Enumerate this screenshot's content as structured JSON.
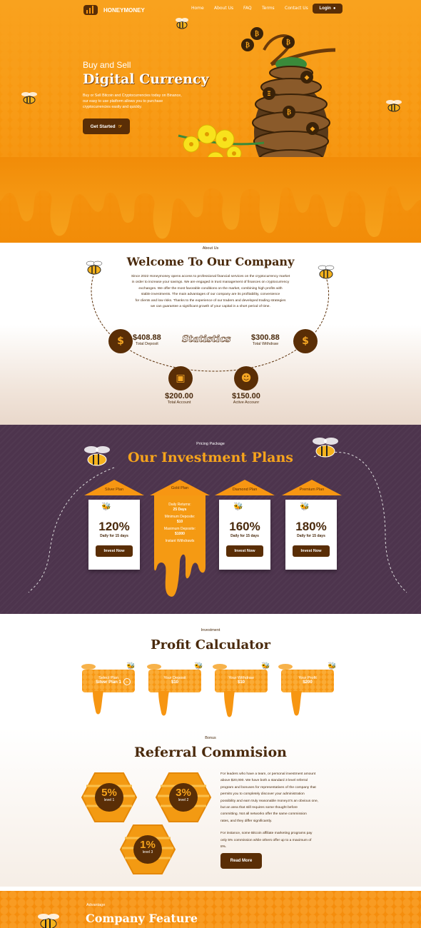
{
  "nav": {
    "brand": "HONEYMONEY",
    "links": [
      "Home",
      "About Us",
      "FAQ",
      "Terms",
      "Contact Us"
    ],
    "login": "Login"
  },
  "hero": {
    "kicker": "Buy and Sell",
    "title": "Digital Currency",
    "text": [
      "Buy or Sell Bitcoin and Cryptocurrencies today on Binance,",
      "our easy to use platform allows you to purchase",
      "cryptocurrencies easily and quickly."
    ],
    "cta": "Get Started",
    "hive_label": "PM"
  },
  "about": {
    "kicker": "About Us",
    "title": "Welcome To Our Company",
    "text": [
      "Since 2022 Honeymoney opens access to professional financial services on the cryptocurrency market",
      "in order to increase your savings. We are engaged in trust management of finances on cryptocurrency",
      "exchanges. We offer the most favorable conditions on the market, combining high profits with",
      "stable investments. The main advantages of our company are its profitability, convenience",
      "for clients and low risks. Thanks to the experience of our traders and developed trading strategies",
      "we can guarantee a significant growth of your capital in a short period of time."
    ],
    "stats_title": "Statistics",
    "stats": [
      {
        "value": "$408.88",
        "label": "Total Deposit"
      },
      {
        "value": "$300.88",
        "label": "Total Withdraw"
      },
      {
        "value": "$200.00",
        "label": "Total Account"
      },
      {
        "value": "$150.00",
        "label": "Active Accounr"
      }
    ]
  },
  "plans": {
    "kicker": "Pricing Package",
    "title": "Our Investment Plans",
    "items": [
      {
        "name": "Silver Plan",
        "pct": "120%",
        "days": "Daily for 15 days",
        "btn": "Invest Now"
      },
      {
        "name": "Diamond Plan",
        "pct": "160%",
        "days": "Daily for 15 days",
        "btn": "Invest Now"
      },
      {
        "name": "Premium Plan",
        "pct": "180%",
        "days": "Daily for 15 days",
        "btn": "Invest Now"
      }
    ],
    "gold": {
      "name": "Gold Plan",
      "lines": [
        [
          "Daily Returns:",
          "25 Days"
        ],
        [
          "Minimum Deposite:",
          "$10"
        ],
        [
          "Maximum Deposite:",
          "$1000"
        ],
        [
          "Instant Withdrawls",
          ""
        ]
      ]
    }
  },
  "calc": {
    "kicker": "Investment",
    "title": "Profit Calculator",
    "boxes": [
      {
        "label": "Select Plan",
        "value": "Silver Plan 1"
      },
      {
        "label": "Your Deposit",
        "value": "$10"
      },
      {
        "label": "Your Withdraw",
        "value": "$10"
      },
      {
        "label": "Your Profit",
        "value": "$200"
      }
    ]
  },
  "referral": {
    "kicker": "Bonus",
    "title": "Referral Commision",
    "levels": [
      {
        "pct": "5%",
        "level": "level 1"
      },
      {
        "pct": "3%",
        "level": "level 2"
      },
      {
        "pct": "1%",
        "level": "level 3"
      }
    ],
    "p1": [
      "For leaders who have a team, or personal investment amount",
      "above $20,000.   We have both a standard 3 level referral",
      "program and bonuses for representatives of the company that",
      "permits you to completely discover your administration",
      "possibility and earn truly reasonable money.It's an obvious one,",
      "but an area that still requires some thought before",
      "committing. Not all networks offer the same commission",
      "rates, and they differ significantly."
    ],
    "p2": [
      "For instance, some Bitcoin affiliate marketing programs pay",
      "only 5% commission while others offer up to a maximum of",
      "8%."
    ],
    "btn": "Read More"
  },
  "feature": {
    "kicker": "Advantage",
    "title": "Company Feature"
  },
  "colors": {
    "honey": "#f79612",
    "brown": "#5a2e06",
    "purple": "#4d344d"
  }
}
